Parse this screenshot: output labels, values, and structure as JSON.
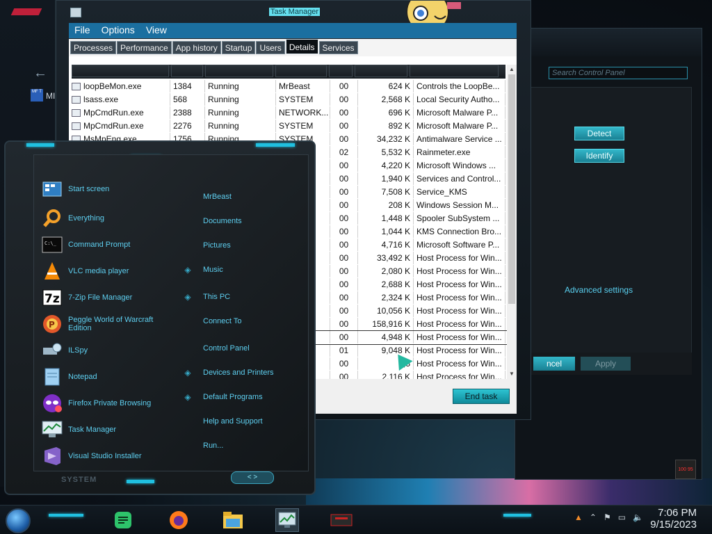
{
  "taskmanager": {
    "title": "Task Manager",
    "menu": [
      "File",
      "Options",
      "View"
    ],
    "tabs": [
      "Processes",
      "Performance",
      "App history",
      "Startup",
      "Users",
      "Details",
      "Services"
    ],
    "active_tab": "Details",
    "rows": [
      {
        "name": "loopBeMon.exe",
        "pid": "1384",
        "status": "Running",
        "user": "MrBeast",
        "cpu": "00",
        "mem": "624 K",
        "desc": "Controls the LoopBe..."
      },
      {
        "name": "lsass.exe",
        "pid": "568",
        "status": "Running",
        "user": "SYSTEM",
        "cpu": "00",
        "mem": "2,568 K",
        "desc": "Local Security Autho..."
      },
      {
        "name": "MpCmdRun.exe",
        "pid": "2388",
        "status": "Running",
        "user": "NETWORK...",
        "cpu": "00",
        "mem": "696 K",
        "desc": "Microsoft Malware P..."
      },
      {
        "name": "MpCmdRun.exe",
        "pid": "2276",
        "status": "Running",
        "user": "SYSTEM",
        "cpu": "00",
        "mem": "892 K",
        "desc": "Microsoft Malware P..."
      },
      {
        "name": "MsMpEng.exe",
        "pid": "1756",
        "status": "Running",
        "user": "SYSTEM",
        "cpu": "00",
        "mem": "34,232 K",
        "desc": "Antimalware Service ..."
      },
      {
        "name": "",
        "pid": "",
        "status": "",
        "user": "",
        "cpu": "02",
        "mem": "5,532 K",
        "desc": "Rainmeter.exe"
      },
      {
        "name": "",
        "pid": "",
        "status": "",
        "user": "",
        "cpu": "00",
        "mem": "4,220 K",
        "desc": "Microsoft Windows ..."
      },
      {
        "name": "",
        "pid": "",
        "status": "",
        "user": "",
        "cpu": "00",
        "mem": "1,940 K",
        "desc": "Services and Control..."
      },
      {
        "name": "",
        "pid": "",
        "status": "",
        "user": "",
        "cpu": "00",
        "mem": "7,508 K",
        "desc": "Service_KMS"
      },
      {
        "name": "",
        "pid": "",
        "status": "",
        "user": "",
        "cpu": "00",
        "mem": "208 K",
        "desc": "Windows Session M..."
      },
      {
        "name": "",
        "pid": "",
        "status": "",
        "user": "",
        "cpu": "00",
        "mem": "1,448 K",
        "desc": "Spooler SubSystem ..."
      },
      {
        "name": "",
        "pid": "",
        "status": "",
        "user": "",
        "cpu": "00",
        "mem": "1,044 K",
        "desc": "KMS Connection Bro..."
      },
      {
        "name": "",
        "pid": "",
        "status": "",
        "user": "",
        "cpu": "00",
        "mem": "4,716 K",
        "desc": "Microsoft Software P..."
      },
      {
        "name": "",
        "pid": "",
        "status": "",
        "user": "",
        "cpu": "00",
        "mem": "33,492 K",
        "desc": "Host Process for Win..."
      },
      {
        "name": "",
        "pid": "",
        "status": "",
        "user": "",
        "cpu": "00",
        "mem": "2,080 K",
        "desc": "Host Process for Win..."
      },
      {
        "name": "",
        "pid": "",
        "status": "",
        "user": "",
        "cpu": "00",
        "mem": "2,688 K",
        "desc": "Host Process for Win..."
      },
      {
        "name": "",
        "pid": "",
        "status": "",
        "user": "",
        "cpu": "00",
        "mem": "2,324 K",
        "desc": "Host Process for Win..."
      },
      {
        "name": "",
        "pid": "",
        "status": "",
        "user": "",
        "cpu": "00",
        "mem": "10,056 K",
        "desc": "Host Process for Win..."
      },
      {
        "name": "",
        "pid": "",
        "status": "",
        "user": "",
        "cpu": "00",
        "mem": "158,916 K",
        "desc": "Host Process for Win..."
      },
      {
        "name": "",
        "pid": "",
        "status": "",
        "user": "",
        "cpu": "00",
        "mem": "4,948 K",
        "desc": "Host Process for Win..."
      },
      {
        "name": "",
        "pid": "",
        "status": "",
        "user": "",
        "cpu": "01",
        "mem": "9,048 K",
        "desc": "Host Process for Win..."
      },
      {
        "name": "",
        "pid": "",
        "status": "",
        "user": "",
        "cpu": "00",
        "mem": "2,5",
        "desc": "Host Process for Win..."
      },
      {
        "name": "",
        "pid": "",
        "status": "",
        "user": "",
        "cpu": "00",
        "mem": "2,116 K",
        "desc": "Host Process for Win..."
      }
    ],
    "end_task_label": "End task"
  },
  "controlpanel": {
    "search_placeholder": "Search Control Panel",
    "detect_label": "Detect",
    "identify_label": "Identify",
    "advanced_link": "Advanced settings",
    "cancel_label": "ncel",
    "apply_label": "Apply",
    "gauge_text": "100 95"
  },
  "left_window": {
    "mft_label": "MF T",
    "text": "MI"
  },
  "startmenu": {
    "left_items": [
      {
        "label": "Start screen",
        "icon": "start-screen-icon"
      },
      {
        "label": "Everything",
        "icon": "everything-search-icon"
      },
      {
        "label": "Command Prompt",
        "icon": "command-prompt-icon"
      },
      {
        "label": "VLC media player",
        "icon": "vlc-icon"
      },
      {
        "label": "7-Zip File Manager",
        "icon": "7zip-icon"
      },
      {
        "label": "Peggle World of Warcraft Edition",
        "icon": "peggle-icon"
      },
      {
        "label": "ILSpy",
        "icon": "ilspy-icon"
      },
      {
        "label": "Notepad",
        "icon": "notepad-icon"
      },
      {
        "label": "Firefox Private Browsing",
        "icon": "firefox-private-icon"
      },
      {
        "label": "Task Manager",
        "icon": "task-manager-icon"
      },
      {
        "label": "Visual Studio Installer",
        "icon": "visual-studio-installer-icon"
      }
    ],
    "right_items": [
      "MrBeast",
      "Documents",
      "Pictures",
      "Music",
      "This PC",
      "Connect To",
      "Control Panel",
      "Devices and Printers",
      "Default Programs",
      "Help and Support",
      "Run..."
    ],
    "footer": "SYSTEM",
    "nav": "< >"
  },
  "taskbar": {
    "time": "7:06 PM",
    "date": "9/15/2023"
  }
}
